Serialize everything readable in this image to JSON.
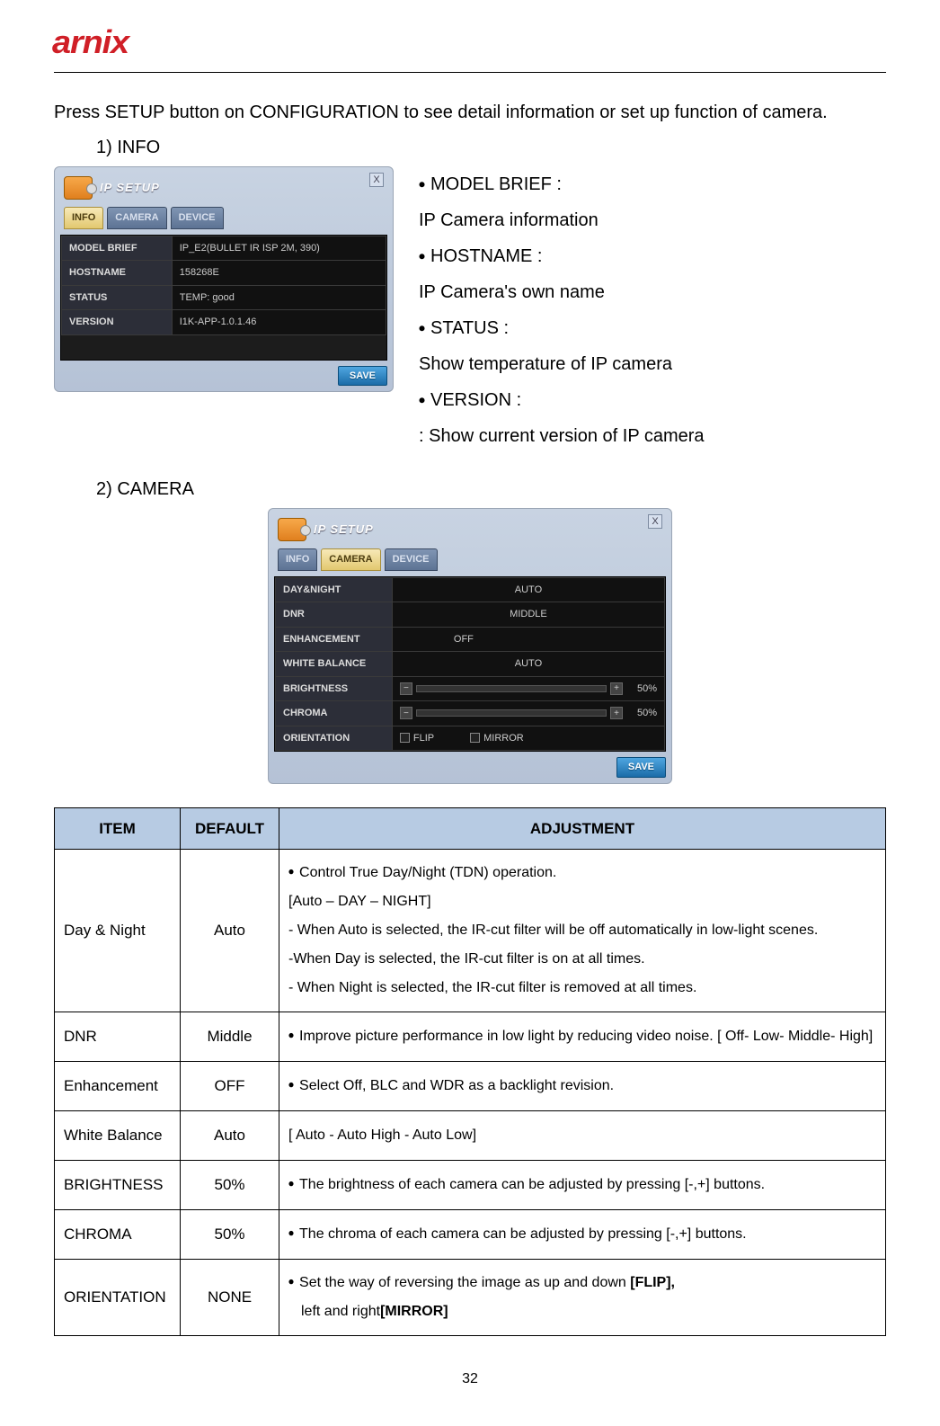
{
  "brand": "arnix",
  "intro": "Press SETUP button on CONFIGURATION to see detail information or set up function of camera.",
  "sections": {
    "info": {
      "number": "1)",
      "title": "INFO",
      "panel": {
        "title": "IP SETUP",
        "tabs": [
          "INFO",
          "CAMERA",
          "DEVICE"
        ],
        "activeTab": "INFO",
        "rows": [
          {
            "label": "MODEL BRIEF",
            "value": "IP_E2(BULLET IR ISP 2M, 390)"
          },
          {
            "label": "HOSTNAME",
            "value": "158268E"
          },
          {
            "label": "STATUS",
            "value": "TEMP: good"
          },
          {
            "label": "VERSION",
            "value": "I1K-APP-1.0.1.46"
          }
        ],
        "save": "SAVE"
      },
      "desc": [
        {
          "type": "bullet",
          "text": "MODEL BRIEF :"
        },
        {
          "type": "line",
          "text": "IP Camera information"
        },
        {
          "type": "bullet",
          "text": "HOSTNAME :"
        },
        {
          "type": "line",
          "text": "IP Camera's own name"
        },
        {
          "type": "bullet",
          "text": "STATUS :"
        },
        {
          "type": "line",
          "text": "Show temperature of IP camera"
        },
        {
          "type": "bullet",
          "text": "VERSION :"
        },
        {
          "type": "line",
          "text": ": Show current version of IP camera"
        }
      ]
    },
    "camera": {
      "number": "2)",
      "title": "CAMERA",
      "panel": {
        "title": "IP SETUP",
        "tabs": [
          "INFO",
          "CAMERA",
          "DEVICE"
        ],
        "activeTab": "CAMERA",
        "rows": [
          {
            "label": "DAY&NIGHT",
            "kind": "center",
            "value": "AUTO"
          },
          {
            "label": "DNR",
            "kind": "center",
            "value": "MIDDLE"
          },
          {
            "label": "ENHANCEMENT",
            "kind": "left",
            "value": "OFF"
          },
          {
            "label": "WHITE BALANCE",
            "kind": "center",
            "value": "AUTO"
          },
          {
            "label": "BRIGHTNESS",
            "kind": "slider",
            "value": "50%"
          },
          {
            "label": "CHROMA",
            "kind": "slider",
            "value": "50%"
          },
          {
            "label": "ORIENTATION",
            "kind": "checks",
            "checks": [
              "FLIP",
              "MIRROR"
            ]
          }
        ],
        "save": "SAVE"
      }
    }
  },
  "spec_headers": [
    "ITEM",
    "DEFAULT",
    "ADJUSTMENT"
  ],
  "spec_rows": [
    {
      "item": "Day & Night",
      "default": "Auto",
      "adj": [
        {
          "t": "b",
          "text": "Control True Day/Night (TDN) operation."
        },
        {
          "t": "p",
          "text": "[Auto – DAY – NIGHT]"
        },
        {
          "t": "p",
          "text": "- When Auto is selected, the IR-cut filter will be off automatically in low-light scenes."
        },
        {
          "t": "p",
          "text": "-When Day is selected, the IR-cut filter is on at all times."
        },
        {
          "t": "p",
          "text": "- When Night is selected, the IR-cut filter is removed at all times."
        }
      ]
    },
    {
      "item": "DNR",
      "default": "Middle",
      "adj": [
        {
          "t": "b",
          "text": "Improve picture performance in low light by reducing video noise. [ Off- Low- Middle- High]"
        }
      ]
    },
    {
      "item": "Enhancement",
      "default": "OFF",
      "adj": [
        {
          "t": "b",
          "text": "Select Off, BLC and WDR as a backlight revision."
        }
      ]
    },
    {
      "item": "White Balance",
      "default": "Auto",
      "adj": [
        {
          "t": "p",
          "text": "[ Auto -   Auto High - Auto Low]"
        }
      ]
    },
    {
      "item": "BRIGHTNESS",
      "default": "50%",
      "adj": [
        {
          "t": "b",
          "text": "The brightness of each camera can be adjusted by pressing [-,+] buttons."
        }
      ]
    },
    {
      "item": "CHROMA",
      "default": "50%",
      "adj": [
        {
          "t": "b",
          "text": "The chroma of each camera can be adjusted by pressing [-,+] buttons."
        }
      ]
    },
    {
      "item": "ORIENTATION",
      "default": "NONE",
      "adj": [
        {
          "t": "b",
          "text": "Set the way of reversing the image as up and down"
        },
        {
          "t": "strong",
          "text": "[FLIP],"
        },
        {
          "t": "br"
        },
        {
          "t": "indent",
          "text": "left and right"
        },
        {
          "t": "strong",
          "text": "[MIRROR]"
        }
      ]
    }
  ],
  "page_number": "32"
}
